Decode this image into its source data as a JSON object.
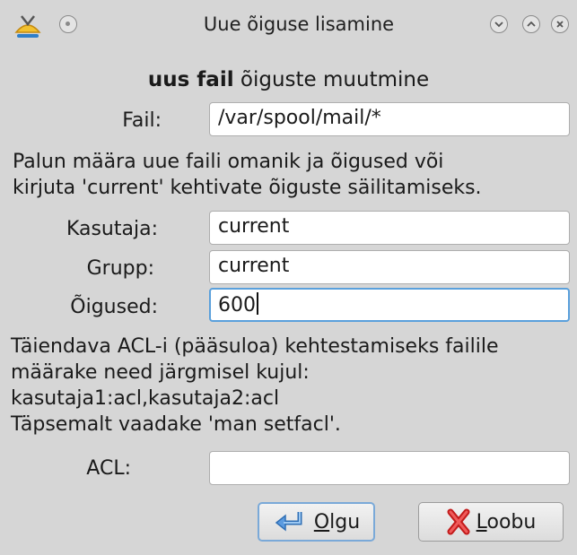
{
  "window": {
    "title": "Uue õiguse lisamine"
  },
  "heading": {
    "bold": "uus fail",
    "rest": " õiguste muutmine"
  },
  "file": {
    "label": "Fail:",
    "value": "/var/spool/mail/*"
  },
  "instructions": "Palun määra uue faili omanik ja õigused või\nkirjuta 'current' kehtivate õiguste säilitamiseks.",
  "user": {
    "label": "Kasutaja:",
    "value": "current"
  },
  "group": {
    "label": "Grupp:",
    "value": "current"
  },
  "permissions": {
    "label": "Õigused:",
    "value": "600"
  },
  "acl_help": "Täiendava ACL-i (pääsuloa) kehtestamiseks failile\nmäärake need järgmisel kujul:\nkasutaja1:acl,kasutaja2:acl\nTäpsemalt vaadake 'man setfacl'.",
  "acl": {
    "label": "ACL:",
    "value": ""
  },
  "buttons": {
    "ok": {
      "accel": "O",
      "rest": "lgu"
    },
    "cancel": {
      "accel": "L",
      "rest": "oobu"
    }
  },
  "colors": {
    "focus_border": "#5aa0dc",
    "background": "#d6d6d6"
  }
}
